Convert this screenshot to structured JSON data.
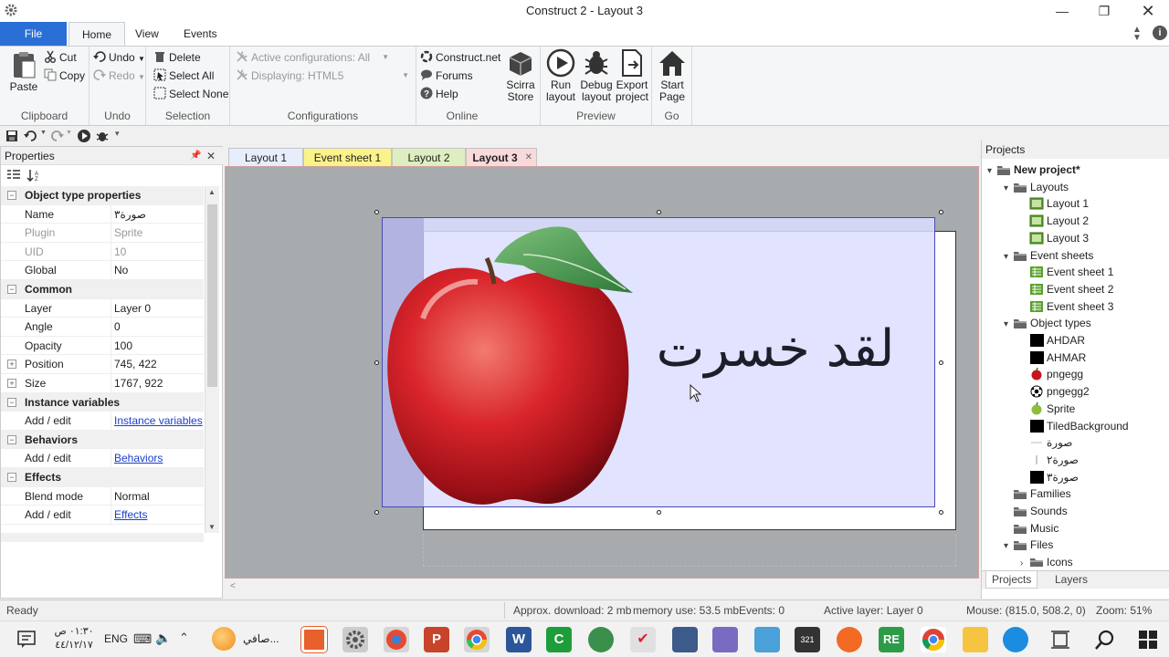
{
  "window": {
    "title": "Construct 2 - Layout 3"
  },
  "ribbon_tabs": [
    "File",
    "Home",
    "View",
    "Events"
  ],
  "ribbon": {
    "clipboard": {
      "paste": "Paste",
      "cut": "Cut",
      "copy": "Copy",
      "label": "Clipboard"
    },
    "undo": {
      "undo": "Undo",
      "redo": "Redo",
      "label": "Undo"
    },
    "selection": {
      "delete": "Delete",
      "select_all": "Select All",
      "select_none": "Select None",
      "label": "Selection"
    },
    "configurations": {
      "active": "Active configurations: All",
      "displaying": "Displaying: HTML5",
      "label": "Configurations"
    },
    "online": {
      "construct_net": "Construct.net",
      "forums": "Forums",
      "help": "Help",
      "label": "Online"
    },
    "store": {
      "line1": "Scirra",
      "line2": "Store"
    },
    "preview": {
      "run1": "Run",
      "run2": "layout",
      "debug1": "Debug",
      "debug2": "layout",
      "export1": "Export",
      "export2": "project",
      "label": "Preview"
    },
    "go": {
      "start1": "Start",
      "start2": "Page",
      "label": "Go"
    }
  },
  "properties": {
    "title": "Properties",
    "rows": [
      {
        "type": "cat",
        "label": "Object type properties"
      },
      {
        "key": "Name",
        "value": "صورة٣"
      },
      {
        "key": "Plugin",
        "value": "Sprite",
        "dim": true
      },
      {
        "key": "UID",
        "value": "10",
        "dim": true
      },
      {
        "key": "Global",
        "value": "No"
      },
      {
        "type": "cat",
        "label": "Common"
      },
      {
        "key": "Layer",
        "value": "Layer 0"
      },
      {
        "key": "Angle",
        "value": "0"
      },
      {
        "key": "Opacity",
        "value": "100"
      },
      {
        "key": "Position",
        "value": "745, 422",
        "expand": true
      },
      {
        "key": "Size",
        "value": "1767, 922",
        "expand": true
      },
      {
        "type": "cat",
        "label": "Instance variables"
      },
      {
        "key": "Add / edit",
        "value": "Instance variables",
        "link": true
      },
      {
        "type": "cat",
        "label": "Behaviors"
      },
      {
        "key": "Add / edit",
        "value": "Behaviors",
        "link": true
      },
      {
        "type": "cat",
        "label": "Effects"
      },
      {
        "key": "Blend mode",
        "value": "Normal"
      },
      {
        "key": "Add / edit",
        "value": "Effects",
        "link": true
      }
    ]
  },
  "doc_tabs": [
    {
      "label": "Layout 1",
      "color": "#e7eefb"
    },
    {
      "label": "Event sheet 1",
      "color": "#fbf38a"
    },
    {
      "label": "Layout 2",
      "color": "#dfeec0"
    },
    {
      "label": "Layout 3",
      "color": "#f9d9d9",
      "active": true
    }
  ],
  "canvas": {
    "arabic_text": "لقد خسرت"
  },
  "projects": {
    "title": "Projects",
    "root": "New project*",
    "layouts_label": "Layouts",
    "layouts": [
      "Layout 1",
      "Layout 2",
      "Layout 3"
    ],
    "events_label": "Event sheets",
    "events": [
      "Event sheet 1",
      "Event sheet 2",
      "Event sheet 3"
    ],
    "objects_label": "Object types",
    "objects": [
      "AHDAR",
      "AHMAR",
      "pngegg",
      "pngegg2",
      "Sprite",
      "TiledBackground",
      "صورة",
      "صورة٢",
      "صورة٣"
    ],
    "families": "Families",
    "sounds": "Sounds",
    "music": "Music",
    "files": "Files",
    "icons": "Icons",
    "bottom_tabs": [
      "Projects",
      "Layers"
    ]
  },
  "status": {
    "ready": "Ready",
    "download": "Approx. download: 2 mb",
    "memory": "memory use: 53.5 mb",
    "events": "Events: 0",
    "layer": "Active layer: Layer 0",
    "mouse": "Mouse: (815.0, 508.2, 0)",
    "zoom": "Zoom: 51%"
  },
  "taskbar": {
    "time": "٠١:٣٠ ص",
    "date": "٤٤/١٢/١٧",
    "lang": "ENG",
    "app_label": "صافي..."
  }
}
